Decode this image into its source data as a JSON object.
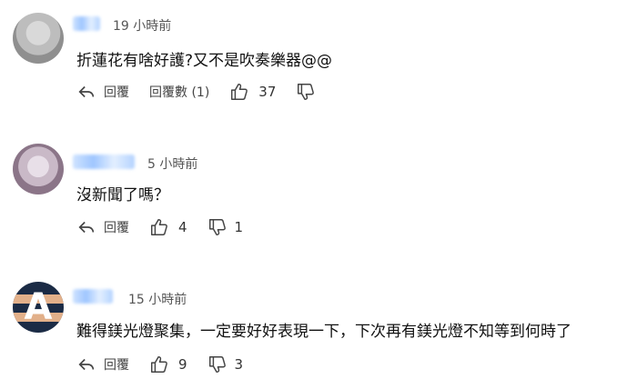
{
  "comments": [
    {
      "time": "19 小時前",
      "text": "折蓮花有啥好護?又不是吹奏樂器@@",
      "reply_label": "回覆",
      "replies_label": "回覆數 (1)",
      "likes": "37",
      "dislikes": ""
    },
    {
      "time": "5 小時前",
      "text": "沒新聞了嗎？",
      "reply_label": "回覆",
      "likes": "4",
      "dislikes": "1"
    },
    {
      "time": "15 小時前",
      "text": "難得鎂光燈聚集，一定要好好表現一下，下次再有鎂光燈不知等到何時了",
      "reply_label": "回覆",
      "likes": "9",
      "dislikes": "3",
      "avatar_letter": "A"
    }
  ]
}
